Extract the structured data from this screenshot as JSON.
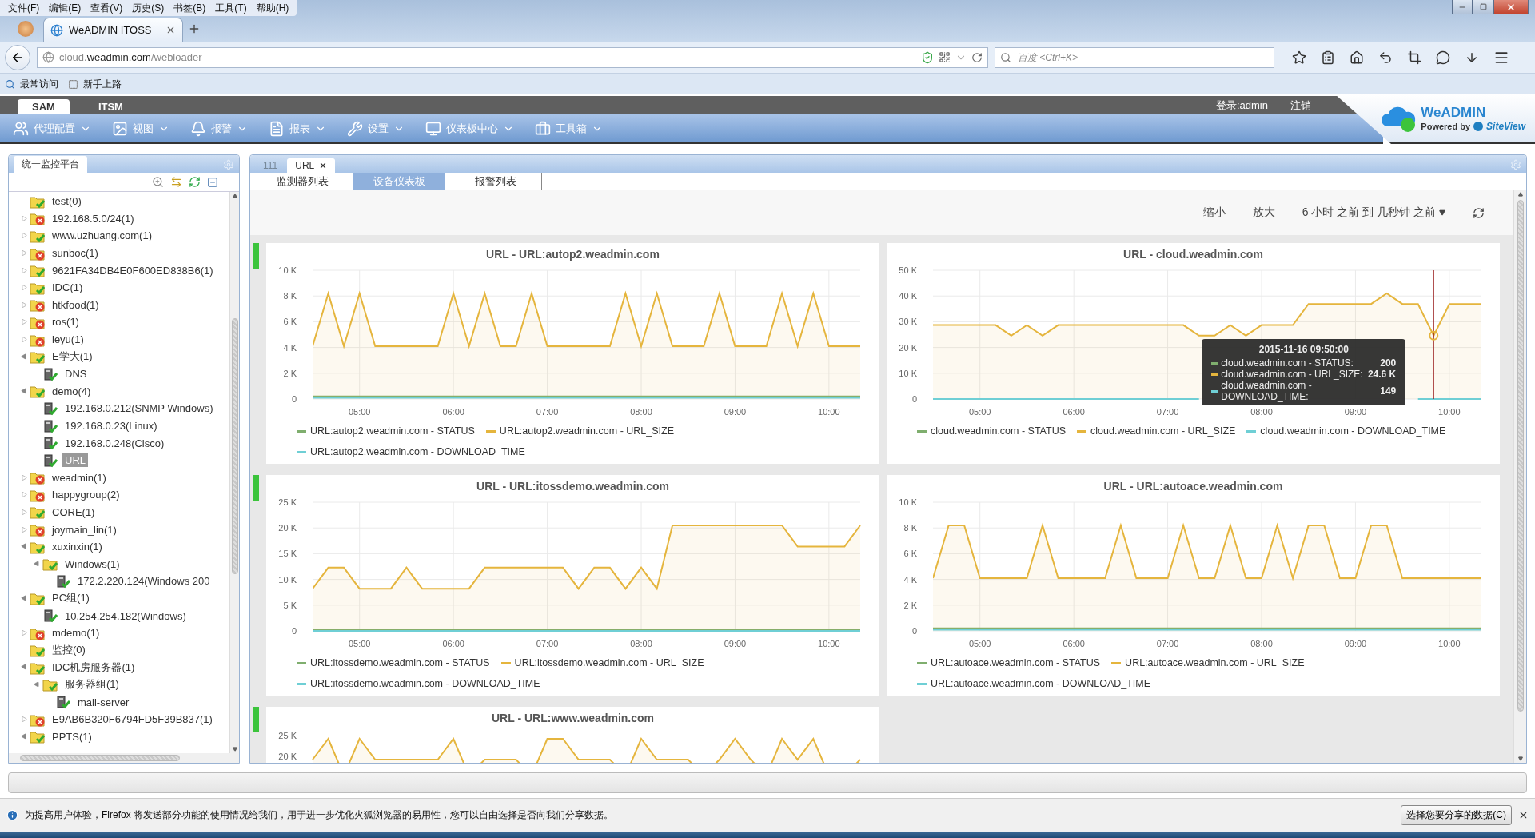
{
  "browser": {
    "menu": [
      "文件(F)",
      "编辑(E)",
      "查看(V)",
      "历史(S)",
      "书签(B)",
      "工具(T)",
      "帮助(H)"
    ],
    "tab": {
      "title": "WeADMIN ITOSS",
      "selected": true
    },
    "address": "cloud.**weadmin.com**/webloader",
    "search": {
      "placeholder": "百度 <Ctrl+K>"
    },
    "bookmarks": [
      "最常访问",
      "新手上路"
    ]
  },
  "app": {
    "modules": [
      {
        "label": "SAM",
        "selected": true
      },
      {
        "label": "ITSM",
        "selected": false
      }
    ],
    "login": "登录:admin",
    "logout": "注销",
    "logo": {
      "name": "WeADMIN",
      "powered_by": "Powered by",
      "partner": "SiteView"
    },
    "toolbar": [
      {
        "label": "代理配置",
        "kind": "agent"
      },
      {
        "label": "视图",
        "kind": "view"
      },
      {
        "label": "报警",
        "kind": "alarm"
      },
      {
        "label": "报表",
        "kind": "report"
      },
      {
        "label": "设置",
        "kind": "settings"
      },
      {
        "label": "仪表板中心",
        "kind": "dashboard"
      },
      {
        "label": "工具箱",
        "kind": "toolbox"
      }
    ]
  },
  "sidebar": {
    "title": "统一监控平台",
    "tree": [
      {
        "label": "test(0)",
        "kind": "folder",
        "alarm": false,
        "selected": false
      },
      {
        "label": "192.168.5.0/24(1)",
        "kind": "folder",
        "alarm": true,
        "expanded": false,
        "selected": false
      },
      {
        "label": "www.uzhuang.com(1)",
        "kind": "folder",
        "alarm": false,
        "expanded": false,
        "selected": false
      },
      {
        "label": "sunboc(1)",
        "kind": "folder",
        "alarm": true,
        "expanded": false,
        "selected": false
      },
      {
        "label": "9621FA34DB4E0F600ED838B6(1)",
        "kind": "folder",
        "alarm": false,
        "expanded": false,
        "selected": false
      },
      {
        "label": "IDC(1)",
        "kind": "folder",
        "alarm": false,
        "expanded": false,
        "selected": false
      },
      {
        "label": "htkfood(1)",
        "kind": "folder",
        "alarm": true,
        "expanded": false,
        "selected": false
      },
      {
        "label": "ros(1)",
        "kind": "folder",
        "alarm": true,
        "expanded": false,
        "selected": false
      },
      {
        "label": "leyu(1)",
        "kind": "folder",
        "alarm": true,
        "expanded": false,
        "selected": false
      },
      {
        "label": "E学大(1)",
        "kind": "folder",
        "alarm": false,
        "expanded": true,
        "selected": false,
        "children": [
          {
            "label": "DNS",
            "kind": "device",
            "alarm": false,
            "selected": false
          }
        ]
      },
      {
        "label": "demo(4)",
        "kind": "folder",
        "alarm": false,
        "expanded": true,
        "selected": false,
        "children": [
          {
            "label": "192.168.0.212(SNMP Windows)",
            "kind": "device",
            "alarm": false,
            "selected": false
          },
          {
            "label": "192.168.0.23(Linux)",
            "kind": "device",
            "alarm": false,
            "selected": false
          },
          {
            "label": "192.168.0.248(Cisco)",
            "kind": "device",
            "alarm": false,
            "selected": false
          },
          {
            "label": "URL",
            "kind": "device",
            "alarm": false,
            "selected": true
          }
        ]
      },
      {
        "label": "weadmin(1)",
        "kind": "folder",
        "alarm": true,
        "expanded": false,
        "selected": false
      },
      {
        "label": "happygroup(2)",
        "kind": "folder",
        "alarm": true,
        "expanded": false,
        "selected": false
      },
      {
        "label": "CORE(1)",
        "kind": "folder",
        "alarm": false,
        "expanded": false,
        "selected": false
      },
      {
        "label": "joymain_lin(1)",
        "kind": "folder",
        "alarm": true,
        "expanded": false,
        "selected": false
      },
      {
        "label": "xuxinxin(1)",
        "kind": "folder",
        "alarm": false,
        "expanded": true,
        "selected": false,
        "children": [
          {
            "label": "Windows(1)",
            "kind": "folder",
            "alarm": false,
            "expanded": true,
            "selected": false,
            "children": [
              {
                "label": "172.2.220.124(Windows 200",
                "kind": "device",
                "alarm": false,
                "selected": false
              }
            ]
          }
        ]
      },
      {
        "label": "PC组(1)",
        "kind": "folder",
        "alarm": false,
        "expanded": true,
        "selected": false,
        "children": [
          {
            "label": "10.254.254.182(Windows)",
            "kind": "device",
            "alarm": false,
            "selected": false
          }
        ]
      },
      {
        "label": "mdemo(1)",
        "kind": "folder",
        "alarm": true,
        "expanded": false,
        "selected": false
      },
      {
        "label": "监控(0)",
        "kind": "folder",
        "alarm": false,
        "selected": false
      },
      {
        "label": "IDC机房服务器(1)",
        "kind": "folder",
        "alarm": false,
        "expanded": true,
        "selected": false,
        "children": [
          {
            "label": "服务器组(1)",
            "kind": "folder",
            "alarm": false,
            "expanded": true,
            "selected": false,
            "children": [
              {
                "label": "mail-server",
                "kind": "device",
                "alarm": false,
                "selected": false
              }
            ]
          }
        ]
      },
      {
        "label": "E9AB6B320F6794FD5F39B837(1)",
        "kind": "folder",
        "alarm": true,
        "expanded": false,
        "selected": false
      },
      {
        "label": "PPTS(1)",
        "kind": "folder",
        "alarm": false,
        "expanded": true,
        "selected": false
      }
    ]
  },
  "workspace": {
    "tabs": [
      {
        "label": "111",
        "selected": false,
        "closable": false
      },
      {
        "label": "URL",
        "selected": true,
        "closable": true
      }
    ],
    "subtabs": [
      {
        "label": "监测器列表",
        "selected": false
      },
      {
        "label": "设备仪表板",
        "selected": true
      },
      {
        "label": "报警列表",
        "selected": false
      }
    ],
    "zoom_out": "缩小",
    "zoom_in": "放大",
    "range": "6 小时 之前 到 几秒钟 之前",
    "charts": [
      {
        "chart_data": {
          "type": "area",
          "title": "URL - URL:autop2.weadmin.com",
          "grid": true,
          "x": [
            270,
            280,
            290,
            300,
            310,
            320,
            330,
            340,
            350,
            360,
            370,
            380,
            390,
            400,
            410,
            420,
            430,
            440,
            450,
            460,
            470,
            480,
            490,
            500,
            510,
            520,
            530,
            540,
            550,
            560,
            570,
            580,
            590,
            600,
            610,
            620
          ],
          "xlim": [
            270,
            620
          ],
          "ylim": [
            0,
            10000
          ],
          "xticks": [
            {
              "value": 300,
              "label": "05:00"
            },
            {
              "value": 360,
              "label": "06:00"
            },
            {
              "value": 420,
              "label": "07:00"
            },
            {
              "value": 480,
              "label": "08:00"
            },
            {
              "value": 540,
              "label": "09:00"
            },
            {
              "value": 600,
              "label": "10:00"
            }
          ],
          "yticks": [
            {
              "value": 0,
              "label": "0"
            },
            {
              "value": 2000,
              "label": "2 K"
            },
            {
              "value": 4000,
              "label": "4 K"
            },
            {
              "value": 6000,
              "label": "6 K"
            },
            {
              "value": 8000,
              "label": "8 K"
            },
            {
              "value": 10000,
              "label": "10 K"
            }
          ],
          "series": [
            {
              "name": "URL:autop2.weadmin.com - STATUS",
              "type": "line",
              "color": "#7fae6e",
              "values": [
                200,
                200,
                200,
                200,
                200,
                200,
                200,
                200,
                200,
                200,
                200,
                200,
                200,
                200,
                200,
                200,
                200,
                200,
                200,
                200,
                200,
                200,
                200,
                200,
                200,
                200,
                200,
                200,
                200,
                200,
                200,
                200,
                200,
                200,
                200,
                200
              ]
            },
            {
              "name": "URL:autop2.weadmin.com - URL_SIZE",
              "type": "area",
              "color": "#e5b53d",
              "values": [
                4100,
                8200,
                4100,
                8200,
                4100,
                4100,
                4100,
                4100,
                4100,
                8200,
                4100,
                8200,
                4100,
                4100,
                8200,
                4100,
                4100,
                4100,
                4100,
                4100,
                8200,
                4100,
                8200,
                4100,
                4100,
                4100,
                8200,
                4100,
                4100,
                4100,
                8200,
                4100,
                8200,
                4100,
                4100,
                4100
              ]
            },
            {
              "name": "URL:autop2.weadmin.com - DOWNLOAD_TIME",
              "type": "line",
              "color": "#6fcfd5",
              "values": [
                100,
                100,
                100,
                100,
                100,
                100,
                100,
                100,
                100,
                100,
                100,
                100,
                100,
                100,
                100,
                100,
                100,
                100,
                100,
                100,
                100,
                100,
                100,
                100,
                100,
                100,
                100,
                100,
                100,
                100,
                100,
                100,
                100,
                100,
                100,
                100
              ]
            }
          ]
        }
      },
      {
        "chart_data": {
          "type": "area",
          "title": "URL - cloud.weadmin.com",
          "grid": true,
          "x": [
            270,
            280,
            290,
            300,
            310,
            320,
            330,
            340,
            350,
            360,
            370,
            380,
            390,
            400,
            410,
            420,
            430,
            440,
            450,
            460,
            470,
            480,
            490,
            500,
            510,
            520,
            530,
            540,
            550,
            560,
            570,
            580,
            590,
            600,
            610,
            620
          ],
          "xlim": [
            270,
            620
          ],
          "ylim": [
            0,
            50000
          ],
          "xticks": [
            {
              "value": 300,
              "label": "05:00"
            },
            {
              "value": 360,
              "label": "06:00"
            },
            {
              "value": 420,
              "label": "07:00"
            },
            {
              "value": 480,
              "label": "08:00"
            },
            {
              "value": 540,
              "label": "09:00"
            },
            {
              "value": 600,
              "label": "10:00"
            }
          ],
          "yticks": [
            {
              "value": 0,
              "label": "0"
            },
            {
              "value": 10000,
              "label": "10 K"
            },
            {
              "value": 20000,
              "label": "20 K"
            },
            {
              "value": 30000,
              "label": "30 K"
            },
            {
              "value": 40000,
              "label": "40 K"
            },
            {
              "value": 50000,
              "label": "50 K"
            }
          ],
          "ref_lines": [
            {
              "axis": "x",
              "value": 590,
              "color": "#9b2020"
            }
          ],
          "series": [
            {
              "name": "cloud.weadmin.com - STATUS",
              "type": "line",
              "color": "#7fae6e",
              "values": [
                null,
                null,
                null,
                null,
                null,
                null,
                null,
                null,
                null,
                null,
                null,
                null,
                null,
                null,
                null,
                null,
                null,
                null,
                null,
                null,
                null,
                null,
                null,
                null,
                null,
                null,
                null,
                null,
                null,
                null,
                null,
                null,
                null,
                null,
                null,
                null
              ]
            },
            {
              "name": "cloud.weadmin.com - URL_SIZE",
              "type": "area",
              "color": "#e5b53d",
              "values": [
                28700,
                28700,
                28700,
                28700,
                28700,
                24600,
                28700,
                24600,
                28700,
                28700,
                28700,
                28700,
                28700,
                28700,
                28700,
                28700,
                28700,
                24600,
                24600,
                28700,
                24600,
                28700,
                28700,
                28700,
                36900,
                36900,
                36900,
                36900,
                36900,
                41000,
                36900,
                36900,
                24600,
                36900,
                36900,
                36900
              ]
            },
            {
              "name": "cloud.weadmin.com - DOWNLOAD_TIME",
              "type": "line",
              "color": "#6fcfd5",
              "values": [
                0,
                0,
                0,
                0,
                0,
                0,
                0,
                0,
                0,
                0,
                0,
                0,
                0,
                0,
                0,
                0,
                0,
                0,
                null,
                null,
                null,
                null,
                null,
                null,
                null,
                null,
                null,
                null,
                null,
                null,
                null,
                0,
                0,
                0,
                0,
                0
              ]
            }
          ]
        },
        "tooltip": {
          "title": "2015-11-16 09:50:00",
          "rows": [
            {
              "label": "cloud.weadmin.com - STATUS:",
              "value": "200"
            },
            {
              "label": "cloud.weadmin.com - URL_SIZE:",
              "value": "24.6 K"
            },
            {
              "label": "cloud.weadmin.com - DOWNLOAD_TIME:",
              "value": "149"
            }
          ]
        }
      },
      {
        "chart_data": {
          "type": "area",
          "title": "URL - URL:itossdemo.weadmin.com",
          "grid": true,
          "x": [
            270,
            280,
            290,
            300,
            310,
            320,
            330,
            340,
            350,
            360,
            370,
            380,
            390,
            400,
            410,
            420,
            430,
            440,
            450,
            460,
            470,
            480,
            490,
            500,
            510,
            520,
            530,
            540,
            550,
            560,
            570,
            580,
            590,
            600,
            610,
            620
          ],
          "xlim": [
            270,
            620
          ],
          "ylim": [
            0,
            25000
          ],
          "xticks": [
            {
              "value": 300,
              "label": "05:00"
            },
            {
              "value": 360,
              "label": "06:00"
            },
            {
              "value": 420,
              "label": "07:00"
            },
            {
              "value": 480,
              "label": "08:00"
            },
            {
              "value": 540,
              "label": "09:00"
            },
            {
              "value": 600,
              "label": "10:00"
            }
          ],
          "yticks": [
            {
              "value": 0,
              "label": "0"
            },
            {
              "value": 5000,
              "label": "5 K"
            },
            {
              "value": 10000,
              "label": "10 K"
            },
            {
              "value": 15000,
              "label": "15 K"
            },
            {
              "value": 20000,
              "label": "20 K"
            },
            {
              "value": 25000,
              "label": "25 K"
            }
          ],
          "series": [
            {
              "name": "URL:itossdemo.weadmin.com - STATUS",
              "type": "line",
              "color": "#7fae6e",
              "values": [
                200,
                200,
                200,
                200,
                200,
                200,
                200,
                200,
                200,
                200,
                200,
                200,
                200,
                200,
                200,
                200,
                200,
                200,
                200,
                200,
                200,
                200,
                200,
                200,
                200,
                200,
                200,
                200,
                200,
                200,
                200,
                200,
                200,
                200,
                200,
                200
              ]
            },
            {
              "name": "URL:itossdemo.weadmin.com - URL_SIZE",
              "type": "area",
              "color": "#e5b53d",
              "values": [
                8200,
                12300,
                12300,
                8200,
                8200,
                8200,
                12300,
                8200,
                8200,
                8200,
                8200,
                12300,
                12300,
                12300,
                12300,
                12300,
                12300,
                8200,
                12300,
                12300,
                8200,
                12300,
                8200,
                20500,
                20500,
                20500,
                20500,
                20500,
                20500,
                20500,
                20500,
                16400,
                16400,
                16400,
                16400,
                20500
              ]
            },
            {
              "name": "URL:itossdemo.weadmin.com - DOWNLOAD_TIME",
              "type": "line",
              "color": "#6fcfd5",
              "values": [
                0,
                0,
                0,
                0,
                0,
                0,
                0,
                0,
                0,
                0,
                0,
                0,
                0,
                0,
                0,
                0,
                0,
                0,
                0,
                0,
                0,
                0,
                0,
                0,
                0,
                0,
                0,
                0,
                0,
                0,
                0,
                0,
                0,
                0,
                0,
                0
              ]
            }
          ]
        }
      },
      {
        "chart_data": {
          "type": "area",
          "title": "URL - URL:autoace.weadmin.com",
          "grid": true,
          "x": [
            270,
            280,
            290,
            300,
            310,
            320,
            330,
            340,
            350,
            360,
            370,
            380,
            390,
            400,
            410,
            420,
            430,
            440,
            450,
            460,
            470,
            480,
            490,
            500,
            510,
            520,
            530,
            540,
            550,
            560,
            570,
            580,
            590,
            600,
            610,
            620
          ],
          "xlim": [
            270,
            620
          ],
          "ylim": [
            0,
            10000
          ],
          "xticks": [
            {
              "value": 300,
              "label": "05:00"
            },
            {
              "value": 360,
              "label": "06:00"
            },
            {
              "value": 420,
              "label": "07:00"
            },
            {
              "value": 480,
              "label": "08:00"
            },
            {
              "value": 540,
              "label": "09:00"
            },
            {
              "value": 600,
              "label": "10:00"
            }
          ],
          "yticks": [
            {
              "value": 0,
              "label": "0"
            },
            {
              "value": 2000,
              "label": "2 K"
            },
            {
              "value": 4000,
              "label": "4 K"
            },
            {
              "value": 6000,
              "label": "6 K"
            },
            {
              "value": 8000,
              "label": "8 K"
            },
            {
              "value": 10000,
              "label": "10 K"
            }
          ],
          "series": [
            {
              "name": "URL:autoace.weadmin.com - STATUS",
              "type": "line",
              "color": "#7fae6e",
              "values": [
                200,
                200,
                200,
                200,
                200,
                200,
                200,
                200,
                200,
                200,
                200,
                200,
                200,
                200,
                200,
                200,
                200,
                200,
                200,
                200,
                200,
                200,
                200,
                200,
                200,
                200,
                200,
                200,
                200,
                200,
                200,
                200,
                200,
                200,
                200,
                200
              ]
            },
            {
              "name": "URL:autoace.weadmin.com - URL_SIZE",
              "type": "area",
              "color": "#e5b53d",
              "values": [
                4100,
                8200,
                8200,
                4100,
                4100,
                4100,
                4100,
                8200,
                4100,
                4100,
                4100,
                4100,
                8200,
                4100,
                4100,
                4100,
                8200,
                4100,
                4100,
                8200,
                4100,
                4100,
                8200,
                4100,
                8200,
                8200,
                4100,
                4100,
                8200,
                8200,
                4100,
                4100,
                4100,
                4100,
                4100,
                4100
              ]
            },
            {
              "name": "URL:autoace.weadmin.com - DOWNLOAD_TIME",
              "type": "line",
              "color": "#6fcfd5",
              "values": [
                100,
                100,
                100,
                100,
                100,
                100,
                100,
                100,
                100,
                100,
                100,
                100,
                100,
                100,
                100,
                100,
                100,
                100,
                100,
                100,
                100,
                100,
                100,
                100,
                100,
                100,
                100,
                100,
                100,
                100,
                100,
                100,
                100,
                100,
                100,
                100
              ]
            }
          ]
        }
      },
      {
        "title": "URL - URL:www.weadmin.com",
        "axis_labels": [
          "25 K",
          "20 K"
        ]
      }
    ]
  },
  "notification": {
    "text": "为提高用户体验，Firefox 将发送部分功能的使用情况给我们，用于进一步优化火狐浏览器的易用性，您可以自由选择是否向我们分享数据。",
    "button": "选择您要分享的数据(C)"
  }
}
